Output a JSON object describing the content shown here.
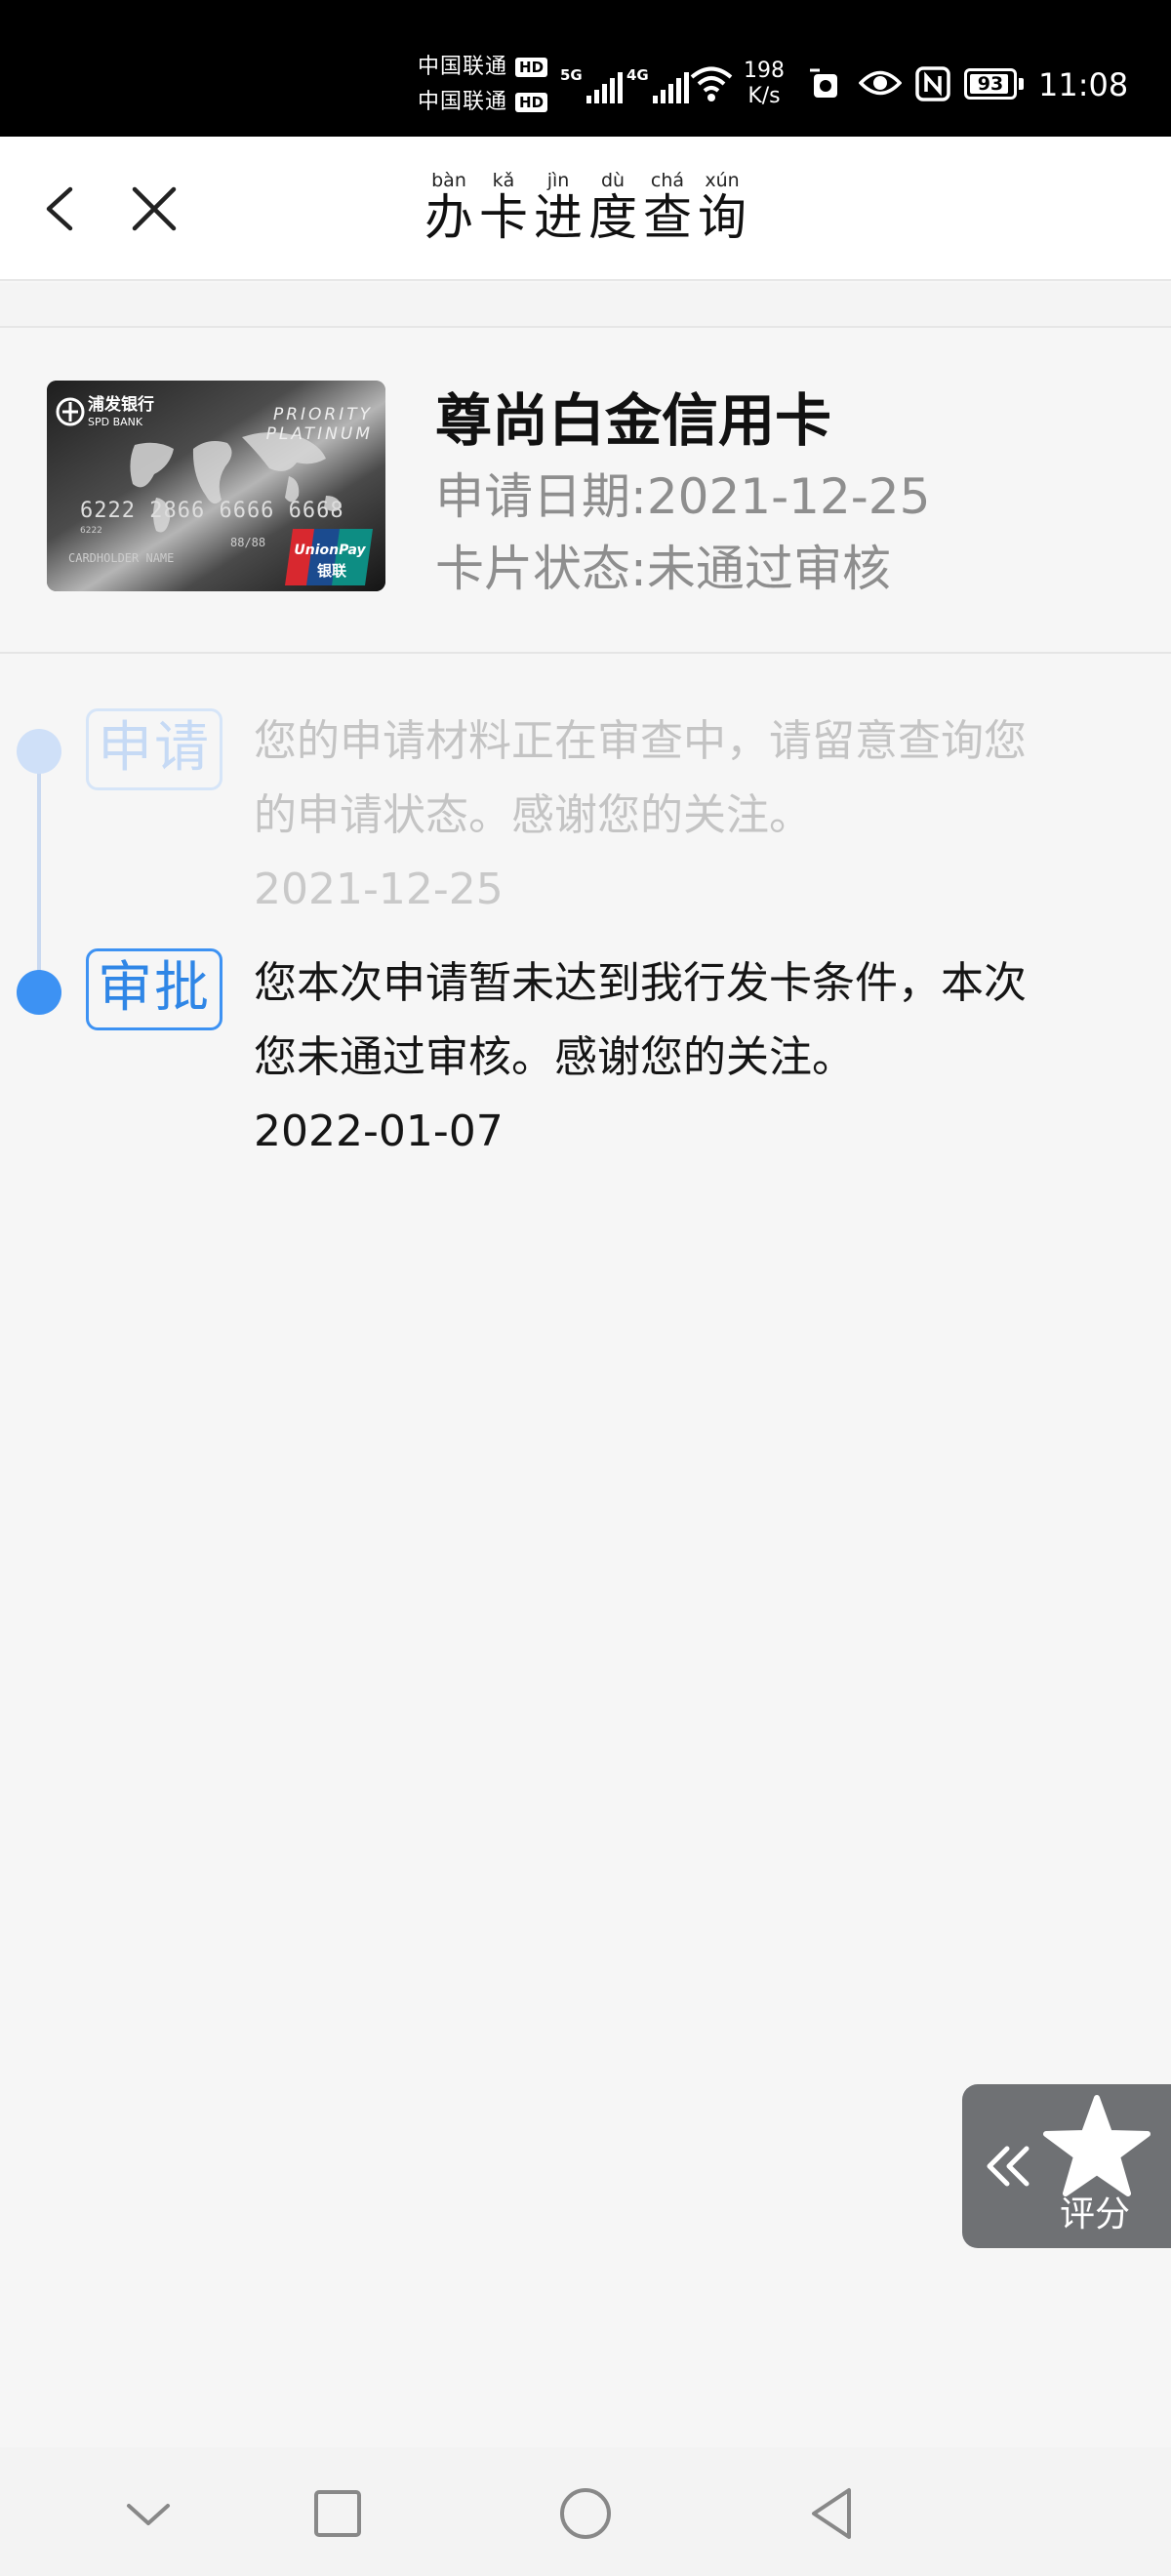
{
  "status_bar": {
    "carriers": [
      {
        "name": "中国联通",
        "badge": "HD"
      },
      {
        "name": "中国联通",
        "badge": "HD"
      }
    ],
    "networks": [
      "5G",
      "4G"
    ],
    "speed_value": "198",
    "speed_unit": "K/s",
    "battery": "93",
    "time": "11:08"
  },
  "header": {
    "title_chars": [
      {
        "char": "办",
        "pinyin": "bàn"
      },
      {
        "char": "卡",
        "pinyin": "kǎ"
      },
      {
        "char": "进",
        "pinyin": "jìn"
      },
      {
        "char": "度",
        "pinyin": "dù"
      },
      {
        "char": "查",
        "pinyin": "chá"
      },
      {
        "char": "询",
        "pinyin": "xún"
      }
    ]
  },
  "card": {
    "name": "尊尚白金信用卡",
    "apply_date": "申请日期:2021-12-25",
    "status": "卡片状态:未通过审核",
    "image": {
      "bank_name_cn": "浦发银行",
      "bank_name_en": "SPD BANK",
      "tier_line1": "PRIORITY",
      "tier_line2": "PLATINUM",
      "number": "6222 2866 6666 6668",
      "bin": "6222",
      "expiry": "88/88",
      "holder": "CARDHOLDER NAME",
      "network_en": "UnionPay",
      "network_cn": "银联"
    }
  },
  "timeline": [
    {
      "stage": "申请",
      "message": "您的申请材料正在审查中，请留意查询您的申请状态。感谢您的关注。",
      "date": "2021-12-25",
      "active": false
    },
    {
      "stage": "审批",
      "message": "您本次申请暂未达到我行发卡条件，本次您未通过审核。感谢您的关注。",
      "date": "2022-01-07",
      "active": true
    }
  ],
  "rating": {
    "label": "评分"
  },
  "colors": {
    "accent": "#3d92f3",
    "accent_faded": "#cfe0f8",
    "muted_text": "#8e8e8e",
    "rating_bg": "#6f7174"
  }
}
